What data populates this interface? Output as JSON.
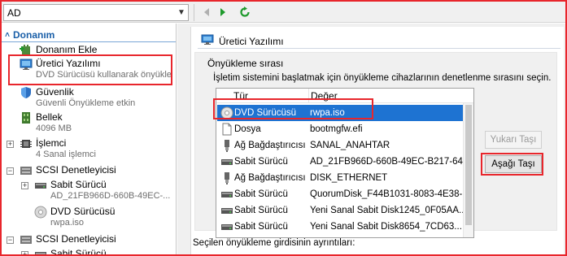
{
  "toolbar": {
    "vm_name": "AD",
    "back_icon": "back-arrow-icon",
    "forward_icon": "forward-arrow-icon",
    "refresh_icon": "refresh-icon"
  },
  "sidebar": {
    "section_title": "Donanım",
    "items": [
      {
        "label": "Donanım Ekle",
        "sub": "",
        "icon": "add-hardware-icon"
      },
      {
        "label": "Üretici Yazılımı",
        "sub": "DVD Sürücüsü kullanarak önyükle",
        "icon": "firmware-icon"
      },
      {
        "label": "Güvenlik",
        "sub": "Güvenli Önyükleme etkin",
        "icon": "shield-icon"
      },
      {
        "label": "Bellek",
        "sub": "4096 MB",
        "icon": "memory-icon"
      },
      {
        "label": "İşlemci",
        "sub": "4 Sanal işlemci",
        "icon": "processor-icon"
      },
      {
        "label": "SCSI Denetleyicisi",
        "sub": "",
        "icon": "scsi-controller-icon"
      },
      {
        "label": "Sabit Sürücü",
        "sub": "AD_21FB966D-660B-49EC-...",
        "icon": "hard-drive-icon"
      },
      {
        "label": "DVD Sürücüsü",
        "sub": "rwpa.iso",
        "icon": "dvd-icon"
      },
      {
        "label": "SCSI Denetleyicisi",
        "sub": "",
        "icon": "scsi-controller-icon"
      },
      {
        "label": "Sabit Sürücü",
        "sub": "",
        "icon": "hard-drive-icon"
      }
    ]
  },
  "main": {
    "title": "Üretici Yazılımı",
    "boot_order_caption": "Önyükleme sırası",
    "boot_order_desc": "İşletim sistemini başlatmak için önyükleme cihazlarının denetlenme sırasını seçin.",
    "columns": [
      "Tür",
      "Değer"
    ],
    "boot_entries": [
      {
        "type": "DVD Sürücüsü",
        "value": "rwpa.iso",
        "icon": "dvd-icon",
        "selected": true
      },
      {
        "type": "Dosya",
        "value": "bootmgfw.efi",
        "icon": "file-icon",
        "selected": false
      },
      {
        "type": "Ağ Bağdaştırıcısı",
        "value": "SANAL_ANAHTAR",
        "icon": "network-adapter-icon",
        "selected": false
      },
      {
        "type": "Sabit Sürücü",
        "value": "AD_21FB966D-660B-49EC-B217-64...",
        "icon": "hard-drive-icon",
        "selected": false
      },
      {
        "type": "Ağ Bağdaştırıcısı",
        "value": "DISK_ETHERNET",
        "icon": "network-adapter-icon",
        "selected": false
      },
      {
        "type": "Sabit Sürücü",
        "value": "QuorumDisk_F44B1031-8083-4E38-...",
        "icon": "hard-drive-icon",
        "selected": false
      },
      {
        "type": "Sabit Sürücü",
        "value": "Yeni Sanal Sabit Disk1245_0F05AA...",
        "icon": "hard-drive-icon",
        "selected": false
      },
      {
        "type": "Sabit Sürücü",
        "value": "Yeni Sanal Sabit Disk8654_7CD63...",
        "icon": "hard-drive-icon",
        "selected": false
      }
    ],
    "move_up_label": "Yukarı Taşı",
    "move_down_label": "Aşağı Taşı",
    "details_label": "Seçilen önyükleme girdisinin ayrıntıları:"
  },
  "colors": {
    "accent": "#1a5fa8",
    "selection": "#1e73d2",
    "highlight": "#e8262c"
  }
}
